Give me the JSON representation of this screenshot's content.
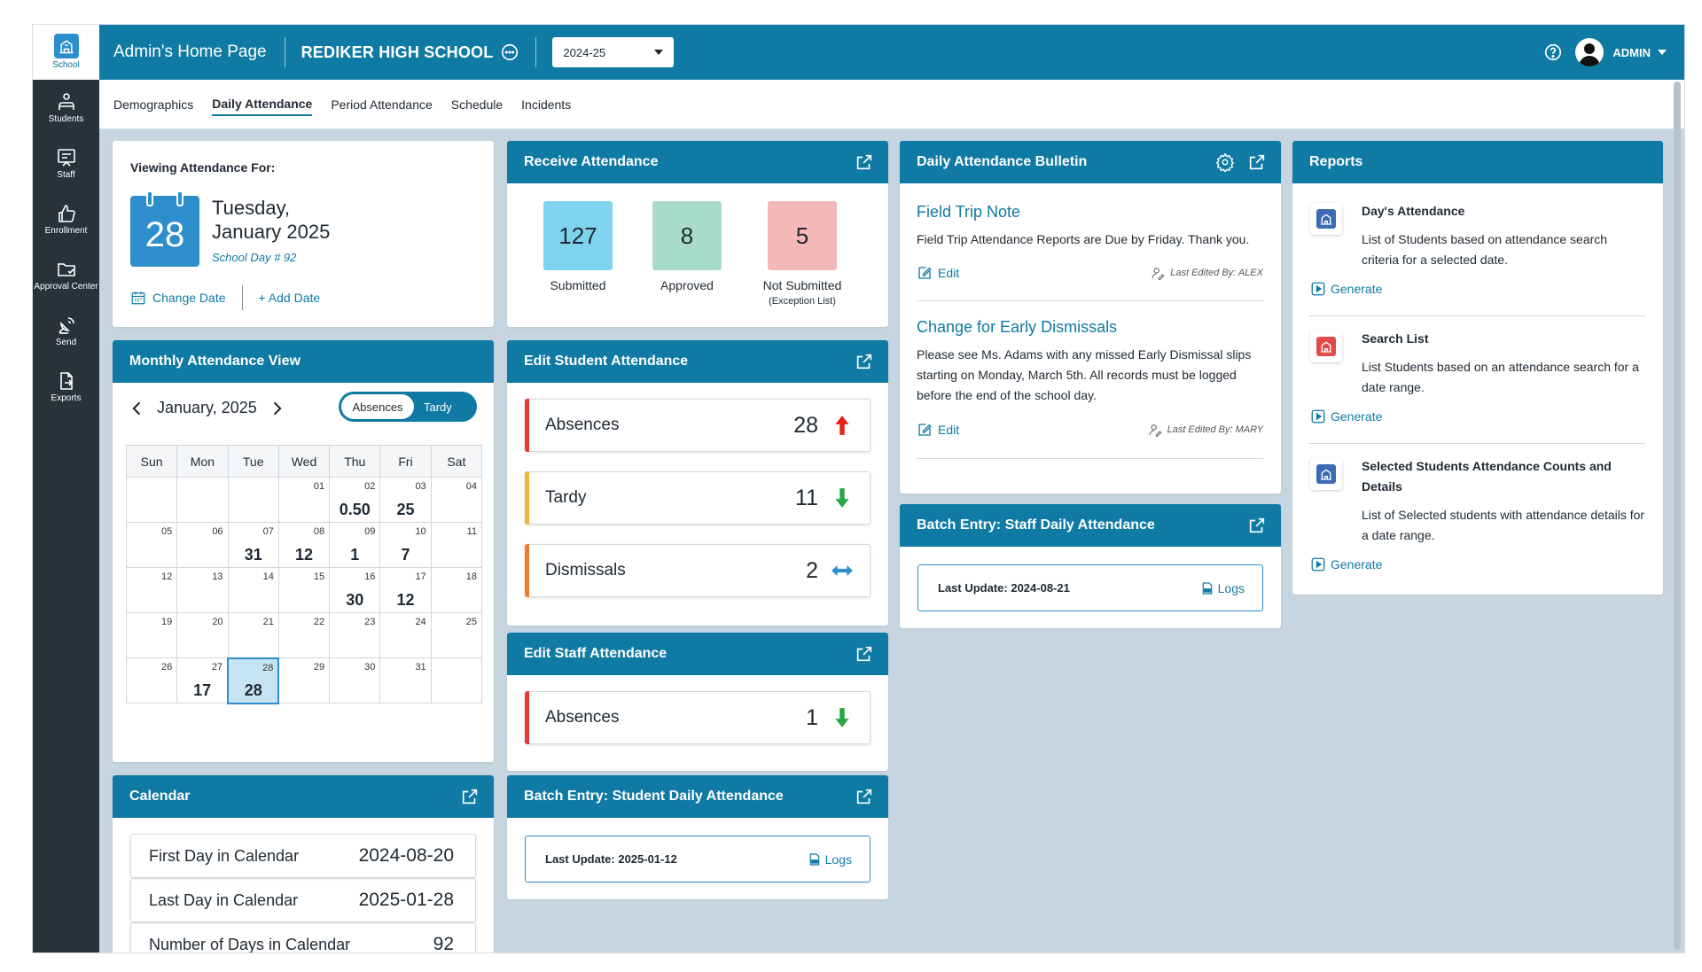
{
  "sidebar": {
    "items": [
      {
        "label": "School",
        "icon": "school-icon"
      },
      {
        "label": "Students",
        "icon": "students-icon"
      },
      {
        "label": "Staff",
        "icon": "staff-icon"
      },
      {
        "label": "Enrollment",
        "icon": "enrollment-icon"
      },
      {
        "label": "Approval Center",
        "icon": "folder-icon"
      },
      {
        "label": "Send",
        "icon": "send-icon"
      },
      {
        "label": "Exports",
        "icon": "export-icon"
      }
    ]
  },
  "header": {
    "page_title": "Admin's Home Page",
    "school_name": "REDIKER HIGH SCHOOL",
    "year": "2024-25",
    "user": "ADMIN"
  },
  "tabs": [
    "Demographics",
    "Daily Attendance",
    "Period Attendance",
    "Schedule",
    "Incidents"
  ],
  "viewing": {
    "label": "Viewing Attendance For:",
    "day_number": "28",
    "weekday": "Tuesday,",
    "month_year": "January 2025",
    "school_day": "School Day # 92",
    "change_date": "Change Date",
    "add_date": "+ Add Date"
  },
  "receive": {
    "title": "Receive Attendance",
    "submitted": {
      "value": "127",
      "label": "Submitted",
      "color": "#7fd3ef"
    },
    "approved": {
      "value": "8",
      "label": "Approved",
      "color": "#a8dcc8"
    },
    "not_submitted": {
      "value": "5",
      "label": "Not Submitted",
      "sub": "(Exception List)",
      "color": "#f5b8b8"
    }
  },
  "monthly": {
    "title": "Monthly Attendance View",
    "month": "January, 2025",
    "toggle_on": "Absences",
    "toggle_off": "Tardy",
    "weekdays": [
      "Sun",
      "Mon",
      "Tue",
      "Wed",
      "Thu",
      "Fri",
      "Sat"
    ],
    "weeks": [
      [
        {
          "d": "",
          "v": ""
        },
        {
          "d": "",
          "v": ""
        },
        {
          "d": "",
          "v": ""
        },
        {
          "d": "01",
          "v": ""
        },
        {
          "d": "02",
          "v": "0.50"
        },
        {
          "d": "03",
          "v": "25"
        },
        {
          "d": "04",
          "v": ""
        }
      ],
      [
        {
          "d": "05",
          "v": ""
        },
        {
          "d": "06",
          "v": ""
        },
        {
          "d": "07",
          "v": "31"
        },
        {
          "d": "08",
          "v": "12"
        },
        {
          "d": "09",
          "v": "1"
        },
        {
          "d": "10",
          "v": "7"
        },
        {
          "d": "11",
          "v": ""
        }
      ],
      [
        {
          "d": "12",
          "v": ""
        },
        {
          "d": "13",
          "v": ""
        },
        {
          "d": "14",
          "v": ""
        },
        {
          "d": "15",
          "v": ""
        },
        {
          "d": "16",
          "v": "30"
        },
        {
          "d": "17",
          "v": "12"
        },
        {
          "d": "18",
          "v": ""
        }
      ],
      [
        {
          "d": "19",
          "v": ""
        },
        {
          "d": "20",
          "v": ""
        },
        {
          "d": "21",
          "v": ""
        },
        {
          "d": "22",
          "v": ""
        },
        {
          "d": "23",
          "v": ""
        },
        {
          "d": "24",
          "v": ""
        },
        {
          "d": "25",
          "v": ""
        }
      ],
      [
        {
          "d": "26",
          "v": ""
        },
        {
          "d": "27",
          "v": "17"
        },
        {
          "d": "28",
          "v": "28",
          "today": true
        },
        {
          "d": "29",
          "v": ""
        },
        {
          "d": "30",
          "v": ""
        },
        {
          "d": "31",
          "v": ""
        },
        {
          "d": "",
          "v": ""
        }
      ]
    ]
  },
  "edit_student": {
    "title": "Edit Student Attendance",
    "rows": [
      {
        "label": "Absences",
        "value": "28",
        "trend": "up",
        "color": "#e53935"
      },
      {
        "label": "Tardy",
        "value": "11",
        "trend": "down",
        "color": "#f2b53c"
      },
      {
        "label": "Dismissals",
        "value": "2",
        "trend": "both",
        "color": "#ef7d2d"
      }
    ]
  },
  "edit_staff": {
    "title": "Edit Staff Attendance",
    "rows": [
      {
        "label": "Absences",
        "value": "1",
        "trend": "down",
        "color": "#e53935"
      }
    ]
  },
  "batch_student": {
    "title": "Batch Entry: Student Daily Attendance",
    "last_update": "Last Update: 2025-01-12",
    "logs": "Logs"
  },
  "bulletin": {
    "title": "Daily Attendance Bulletin",
    "posts": [
      {
        "title": "Field Trip Note",
        "text": "Field Trip Attendance Reports are Due by Friday. Thank you.",
        "edit": "Edit",
        "edited_by": "Last Edited By: ALEX"
      },
      {
        "title": "Change for Early Dismissals",
        "text": "Please see Ms. Adams with any missed Early Dismissal slips starting on Monday, March 5th. All records must be logged before the end of the school day.",
        "edit": "Edit",
        "edited_by": "Last Edited By: MARY"
      }
    ]
  },
  "batch_staff": {
    "title": "Batch Entry: Staff Daily Attendance",
    "last_update": "Last Update: 2024-08-21",
    "logs": "Logs"
  },
  "reports": {
    "title": "Reports",
    "items": [
      {
        "title": "Day's Attendance",
        "desc": "List of Students based on attendance search criteria for a selected date.",
        "action": "Generate",
        "icon_color": "#3d6bb3"
      },
      {
        "title": "Search List",
        "desc": "List Students based on an attendance search for a date range.",
        "action": "Generate",
        "icon_color": "#e24b4b"
      },
      {
        "title": "Selected Students Attendance Counts and Details",
        "desc": "List of Selected students with attendance details for a date range.",
        "action": "Generate",
        "icon_color": "#3d6bb3"
      }
    ]
  },
  "calendar": {
    "title": "Calendar",
    "rows": [
      {
        "label": "First Day in Calendar",
        "value": "2024-08-20"
      },
      {
        "label": "Last Day in Calendar",
        "value": "2025-01-28"
      },
      {
        "label": "Number of Days in Calendar",
        "value": "92"
      }
    ]
  }
}
